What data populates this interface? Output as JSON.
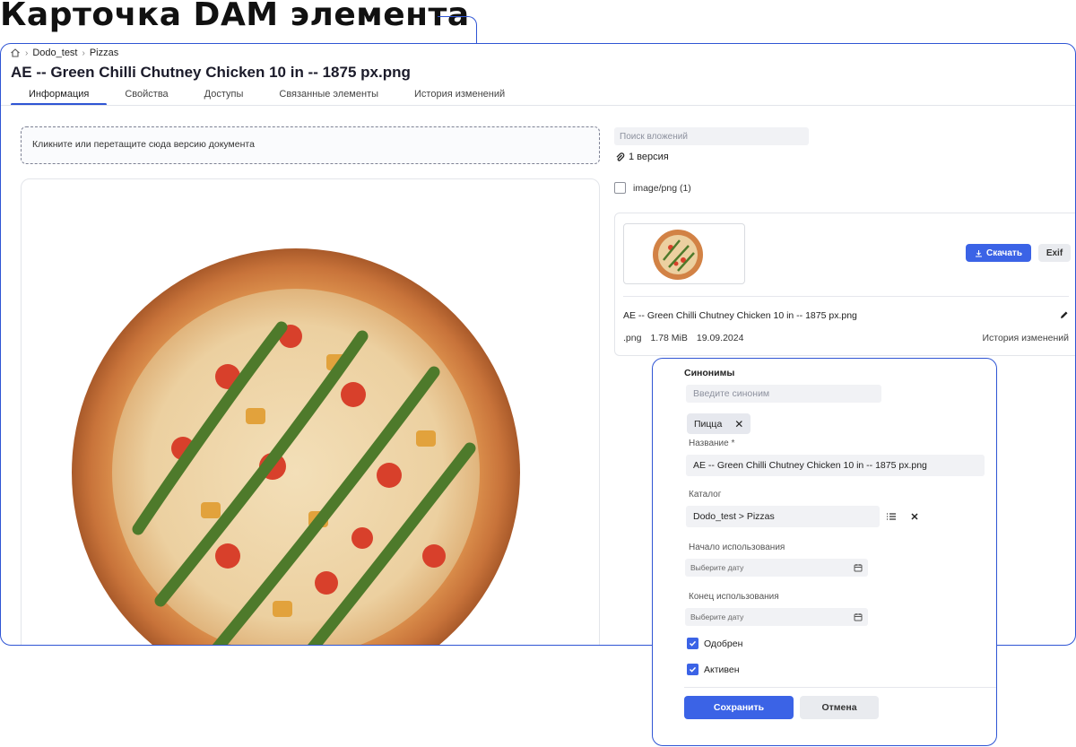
{
  "hero": {
    "title": "Карточка DAM элемента"
  },
  "breadcrumb": {
    "items": [
      "Dodo_test",
      "Pizzas"
    ]
  },
  "page": {
    "title": "AE -- Green Chilli Chutney Chicken 10 in -- 1875 px.png"
  },
  "tabs": [
    {
      "label": "Информация",
      "active": true
    },
    {
      "label": "Свойства",
      "active": false
    },
    {
      "label": "Доступы",
      "active": false
    },
    {
      "label": "Связанные элементы",
      "active": false
    },
    {
      "label": "История изменений",
      "active": false
    }
  ],
  "dropzone": {
    "text": "Кликните или перетащите сюда версию документа"
  },
  "attachments": {
    "search_placeholder": "Поиск вложений",
    "versions_label": "1 версия",
    "filter_label": "image/png (1)"
  },
  "file_card": {
    "download_label": "Скачать",
    "exif_label": "Exif",
    "file_name": "AE -- Green Chilli Chutney Chicken 10 in -- 1875 px.png",
    "ext": ".png",
    "size": "1.78 MiB",
    "date": "19.09.2024",
    "history_label": "История изменений"
  },
  "form": {
    "synonyms_label": "Синонимы",
    "synonym_placeholder": "Введите синоним",
    "synonym_chip": "Пицца",
    "name_label": "Название *",
    "name_value": "AE -- Green Chilli Chutney Chicken 10 in -- 1875 px.png",
    "catalog_label": "Каталог",
    "catalog_value": "Dodo_test > Pizzas",
    "start_label": "Начало использования",
    "start_placeholder": "Выберите дату",
    "end_label": "Конец использования",
    "end_placeholder": "Выберите дату",
    "approved_label": "Одобрен",
    "active_label": "Активен",
    "save_label": "Сохранить",
    "cancel_label": "Отмена"
  },
  "colors": {
    "accent": "#3b63e6",
    "frame": "#2f55d4"
  }
}
